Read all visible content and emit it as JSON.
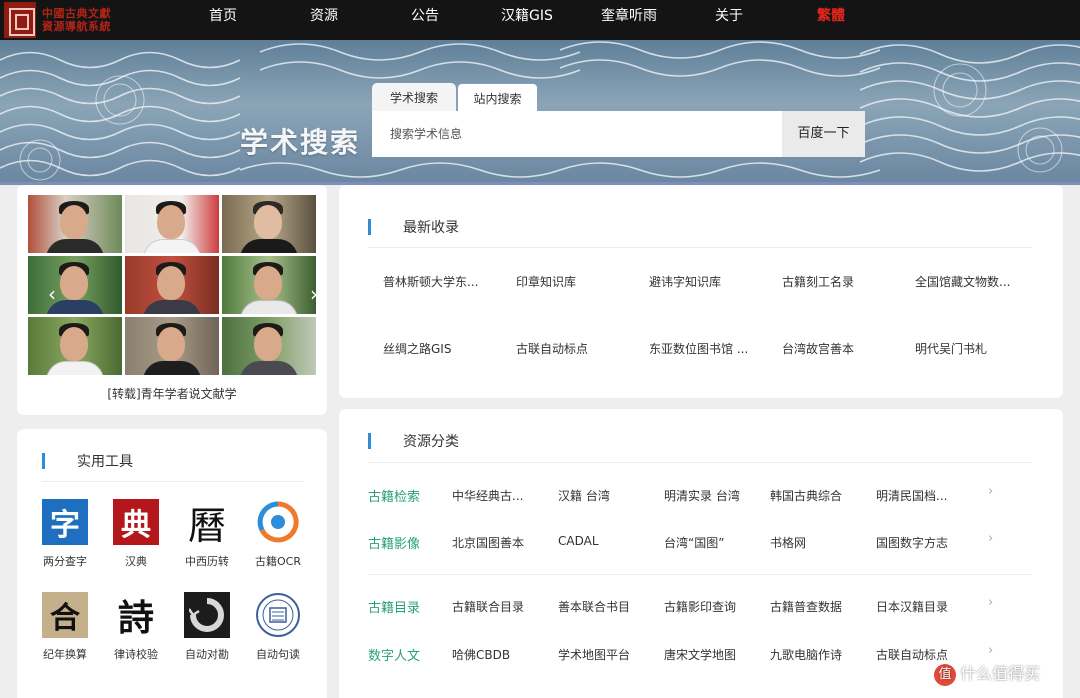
{
  "brand": {
    "line1": "中國古典文獻",
    "line2": "資源導航系統"
  },
  "nav": [
    {
      "label": "首页"
    },
    {
      "label": "资源"
    },
    {
      "label": "公告"
    },
    {
      "label": "汉籍GIS"
    },
    {
      "label": "奎章听雨"
    },
    {
      "label": "关于"
    },
    {
      "label": "繁體"
    }
  ],
  "banner": {
    "title": "学术搜索",
    "tabs": [
      {
        "label": "学术搜索"
      },
      {
        "label": "站内搜索"
      }
    ],
    "search": {
      "placeholder": "搜索学术信息",
      "value": ""
    },
    "search_button": "百度一下"
  },
  "photo_card": {
    "caption": "[转载]青年学者说文献学",
    "prev_icon": "chevron-left-icon",
    "next_icon": "chevron-right-icon"
  },
  "tools": {
    "title": "实用工具",
    "items": [
      {
        "label": "两分查字",
        "glyph": "字",
        "icon": "two-part-lookup-icon"
      },
      {
        "label": "汉典",
        "glyph": "典",
        "icon": "handian-icon"
      },
      {
        "label": "中西历转",
        "glyph": "曆",
        "icon": "calendar-convert-icon"
      },
      {
        "label": "古籍OCR",
        "glyph": "",
        "icon": "ocr-icon"
      },
      {
        "label": "纪年换算",
        "glyph": "合",
        "icon": "era-convert-icon"
      },
      {
        "label": "律诗校验",
        "glyph": "詩",
        "icon": "poem-check-icon"
      },
      {
        "label": "自动对勘",
        "glyph": "",
        "icon": "auto-collate-icon"
      },
      {
        "label": "自动句读",
        "glyph": "",
        "icon": "auto-punctuate-icon"
      }
    ]
  },
  "latest": {
    "title": "最新收录",
    "items": [
      "普林斯顿大学东...",
      "印章知识库",
      "避讳字知识库",
      "古籍刻工名录",
      "全国馆藏文物数...",
      "丝绸之路GIS",
      "古联自动标点",
      "东亚数位图书馆 ...",
      "台湾故宫善本",
      "明代吴门书札"
    ]
  },
  "resources": {
    "title": "资源分类",
    "rows": [
      {
        "category": "古籍检索",
        "items": [
          "中华经典古...",
          "汉籍 台湾",
          "明清实录 台湾",
          "韩国古典综合",
          "明清民国档..."
        ]
      },
      {
        "category": "古籍影像",
        "items": [
          "北京国图善本",
          "CADAL",
          "台湾“国图”",
          "书格网",
          "国图数字方志"
        ]
      },
      {
        "category": "古籍目录",
        "items": [
          "古籍联合目录",
          "善本联合书目",
          "古籍影印查询",
          "古籍普查数据",
          "日本汉籍目录"
        ]
      },
      {
        "category": "数字人文",
        "items": [
          "哈佛CBDB",
          "学术地图平台",
          "唐宋文学地图",
          "九歌电脑作诗",
          "古联自动标点"
        ]
      }
    ]
  },
  "watermark": {
    "badge": "值",
    "text": "什么值得买"
  },
  "colors": {
    "category_green": "#2aa07a",
    "accent_blue": "#2d8dd6",
    "nav_bg": "#141414",
    "nav_red": "#e8251c"
  }
}
